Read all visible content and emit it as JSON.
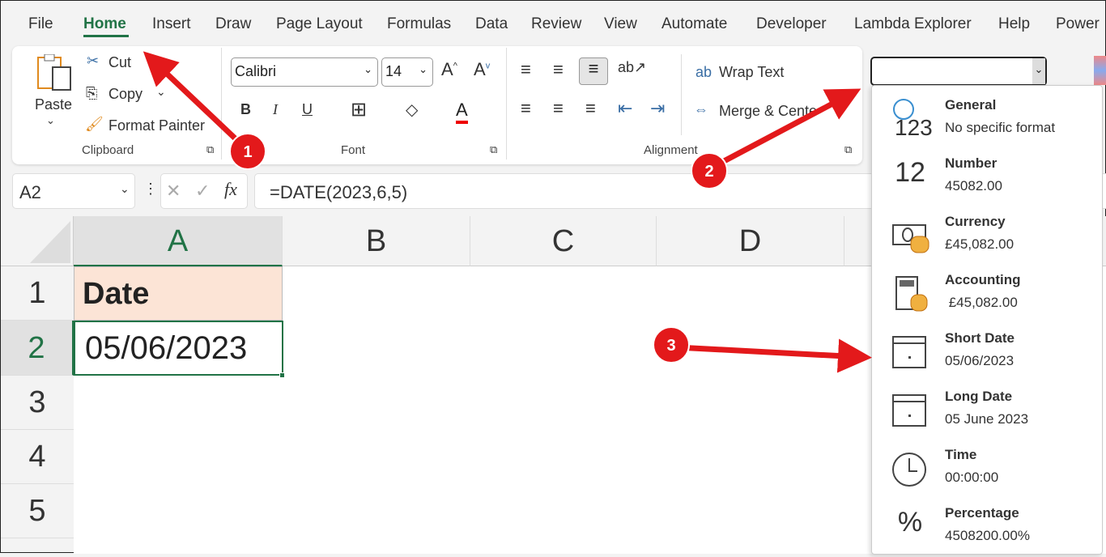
{
  "menu": [
    "File",
    "Home",
    "Insert",
    "Draw",
    "Page Layout",
    "Formulas",
    "Data",
    "Review",
    "View",
    "Automate",
    "Developer",
    "Lambda Explorer",
    "Help",
    "Power"
  ],
  "clipboard": {
    "paste": "Paste",
    "cut": "Cut",
    "copy": "Copy",
    "format_painter": "Format Painter",
    "group": "Clipboard"
  },
  "font": {
    "name": "Calibri",
    "size": "14",
    "bold": "B",
    "italic": "I",
    "underline": "U",
    "group": "Font"
  },
  "alignment": {
    "wrap": "Wrap Text",
    "merge": "Merge & Center",
    "group": "Alignment"
  },
  "number_format": {
    "value": ""
  },
  "formula_bar": {
    "name_box": "A2",
    "fx": "fx",
    "formula": "=DATE(2023,6,5)"
  },
  "columns": [
    "A",
    "B",
    "C",
    "D"
  ],
  "rows": [
    "1",
    "2",
    "3",
    "4",
    "5"
  ],
  "cells": {
    "A1": "Date",
    "A2": "05/06/2023"
  },
  "format_list": [
    {
      "name": "General",
      "example": "No specific format",
      "icon": "clock-123-icon"
    },
    {
      "name": "Number",
      "example": "45082.00",
      "icon": "number-12-icon"
    },
    {
      "name": "Currency",
      "example": "£45,082.00",
      "icon": "banknote-coins-icon"
    },
    {
      "name": "Accounting",
      "example": " £45,082.00",
      "icon": "calculator-coins-icon"
    },
    {
      "name": "Short Date",
      "example": "05/06/2023",
      "icon": "calendar-icon"
    },
    {
      "name": "Long Date",
      "example": "05 June 2023",
      "icon": "calendar-icon"
    },
    {
      "name": "Time",
      "example": "00:00:00",
      "icon": "clock-icon"
    },
    {
      "name": "Percentage",
      "example": "4508200.00%",
      "icon": "percent-icon"
    }
  ],
  "annotations": [
    "1",
    "2",
    "3"
  ],
  "colors": {
    "accent": "#217346",
    "arrow": "#e3191b",
    "header_fill": "#fce4d6"
  }
}
